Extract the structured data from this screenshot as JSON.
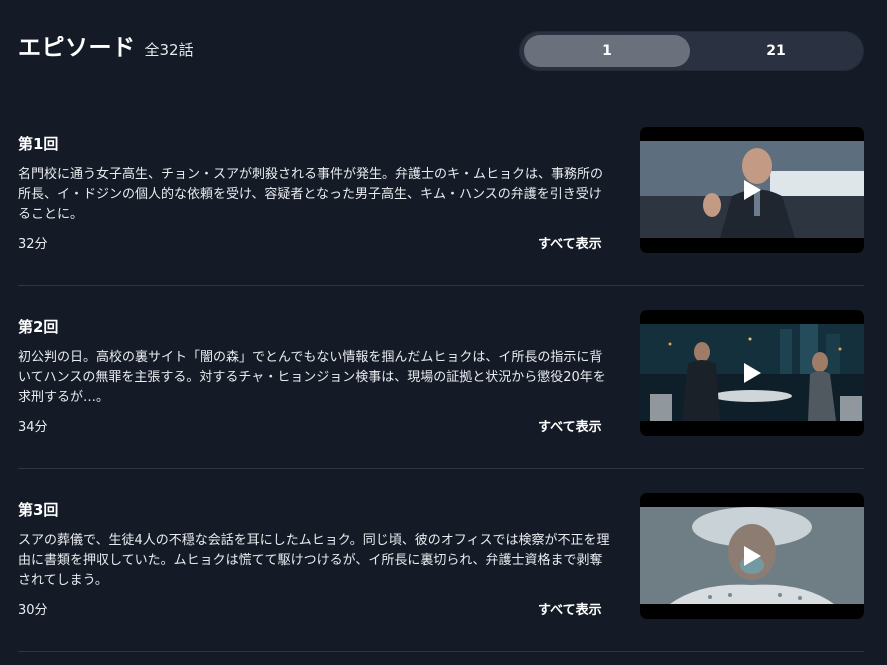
{
  "header": {
    "title": "エピソード",
    "count": "全32話"
  },
  "pager": {
    "active_label": "1",
    "inactive_label": "21"
  },
  "episodes": [
    {
      "title": "第1回",
      "description": "名門校に通う女子高生、チョン・スアが刺殺される事件が発生。弁護士のキ・ムヒョクは、事務所の所長、イ・ドジンの個人的な依頼を受け、容疑者となった男子高生、キム・ハンスの弁護を引き受けることに。",
      "duration": "32分",
      "more_label": "すべて表示"
    },
    {
      "title": "第2回",
      "description": "初公判の日。高校の裏サイト「闇の森」でとんでもない情報を掴んだムヒョクは、イ所長の指示に背いてハンスの無罪を主張する。対するチャ・ヒョンジョン検事は、現場の証拠と状況から懲役20年を求刑するが…。",
      "duration": "34分",
      "more_label": "すべて表示"
    },
    {
      "title": "第3回",
      "description": "スアの葬儀で、生徒4人の不穏な会話を耳にしたムヒョク。同じ頃、彼のオフィスでは検察が不正を理由に書類を押収していた。ムヒョクは慌てて駆けつけるが、イ所長に裏切られ、弁護士資格まで剥奪されてしまう。",
      "duration": "30分",
      "more_label": "すべて表示"
    }
  ],
  "icons": {
    "play": "play-icon"
  }
}
